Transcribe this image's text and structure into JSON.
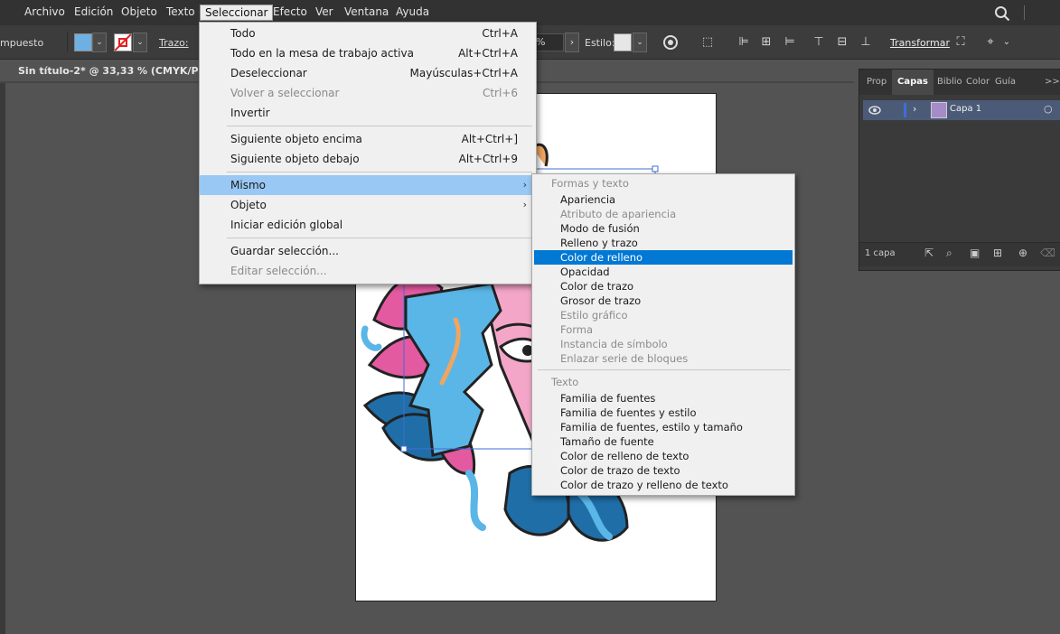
{
  "menubar": {
    "items": [
      "Archivo",
      "Edición",
      "Objeto",
      "Texto",
      "Seleccionar",
      "Efecto",
      "Ver",
      "Ventana",
      "Ayuda"
    ],
    "active": "Seleccionar"
  },
  "control_bar": {
    "left_label": "mpuesto",
    "trazo_label": "Trazo:",
    "fill_color": "#6fb0e3",
    "percent": "%",
    "estilo_label": "Estilo:",
    "transformar_label": "Transformar"
  },
  "document": {
    "tab_title": "Sin título-2* @ 33,33 % (CMYK/Previsu"
  },
  "select_menu": {
    "items": [
      {
        "label": "Todo",
        "shortcut": "Ctrl+A",
        "disabled": false
      },
      {
        "label": "Todo en la mesa de trabajo activa",
        "shortcut": "Alt+Ctrl+A",
        "disabled": false
      },
      {
        "label": "Deseleccionar",
        "shortcut": "Mayúsculas+Ctrl+A",
        "disabled": false
      },
      {
        "label": "Volver a seleccionar",
        "shortcut": "Ctrl+6",
        "disabled": true
      },
      {
        "label": "Invertir",
        "shortcut": "",
        "disabled": false
      },
      {
        "label": "Siguiente objeto encima",
        "shortcut": "Alt+Ctrl+]",
        "disabled": false
      },
      {
        "label": "Siguiente objeto debajo",
        "shortcut": "Alt+Ctrl+9",
        "disabled": false
      },
      {
        "label": "Mismo",
        "shortcut": "",
        "disabled": false,
        "submenu": true,
        "highlighted": true
      },
      {
        "label": "Objeto",
        "shortcut": "",
        "disabled": false,
        "submenu": true
      },
      {
        "label": "Iniciar edición global",
        "shortcut": "",
        "disabled": false
      },
      {
        "label": "Guardar selección...",
        "shortcut": "",
        "disabled": false
      },
      {
        "label": "Editar selección...",
        "shortcut": "",
        "disabled": true
      }
    ]
  },
  "same_submenu": {
    "section1_header": "Formas y texto",
    "section1_items": [
      {
        "label": "Apariencia",
        "disabled": false
      },
      {
        "label": "Atributo de apariencia",
        "disabled": true
      },
      {
        "label": "Modo de fusión",
        "disabled": false
      },
      {
        "label": "Relleno y trazo",
        "disabled": false
      },
      {
        "label": "Color de relleno",
        "disabled": false,
        "selected": true
      },
      {
        "label": "Opacidad",
        "disabled": false
      },
      {
        "label": "Color de trazo",
        "disabled": false
      },
      {
        "label": "Grosor de trazo",
        "disabled": false
      },
      {
        "label": "Estilo gráfico",
        "disabled": true
      },
      {
        "label": "Forma",
        "disabled": true
      },
      {
        "label": "Instancia de símbolo",
        "disabled": true
      },
      {
        "label": "Enlazar serie de bloques",
        "disabled": true
      }
    ],
    "section2_header": "Texto",
    "section2_items": [
      {
        "label": "Familia de fuentes",
        "disabled": false
      },
      {
        "label": "Familia de fuentes y estilo",
        "disabled": false
      },
      {
        "label": "Familia de fuentes, estilo y tamaño",
        "disabled": false
      },
      {
        "label": "Tamaño de fuente",
        "disabled": false
      },
      {
        "label": "Color de relleno de texto",
        "disabled": false
      },
      {
        "label": "Color de trazo de texto",
        "disabled": false
      },
      {
        "label": "Color de trazo y relleno de texto",
        "disabled": false
      }
    ]
  },
  "layers_panel": {
    "tabs": [
      "Prop",
      "Capas",
      "Biblio",
      "Color",
      "Guía"
    ],
    "active_tab": "Capas",
    "more": ">>",
    "layer_name": "Capa 1",
    "footer_count": "1 capa"
  },
  "colors": {
    "menu_bg": "#f0f0f0",
    "menu_highlight": "#99c8f5",
    "submenu_selected": "#0078d4",
    "artwork_blue": "#5ab6e6",
    "artwork_pink": "#e35aa0",
    "artwork_darkblue": "#1f6ea8"
  }
}
